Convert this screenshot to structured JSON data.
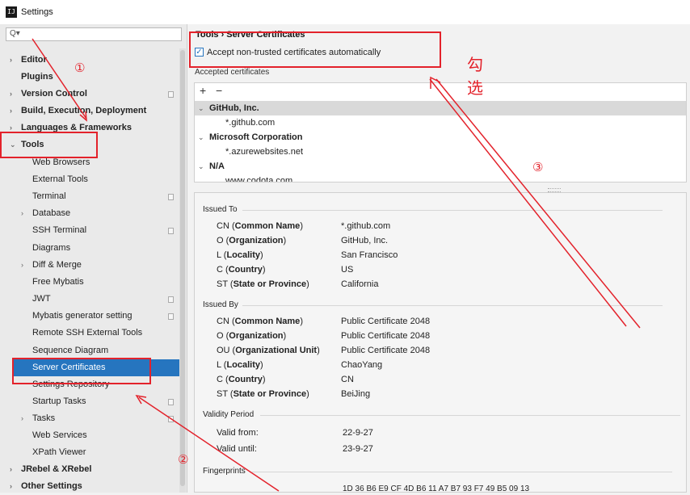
{
  "window": {
    "title": "Settings",
    "app_icon_text": "IJ"
  },
  "search": {
    "value": "",
    "placeholder": ""
  },
  "sidebar": {
    "items": [
      {
        "label": "Editor",
        "expander": "›"
      },
      {
        "label": "Plugins",
        "expander": ""
      },
      {
        "label": "Version Control",
        "expander": "›"
      },
      {
        "label": "Build, Execution, Deployment",
        "expander": "›"
      },
      {
        "label": "Languages & Frameworks",
        "expander": "›"
      },
      {
        "label": "Tools",
        "expander": "⌄"
      },
      {
        "label": "Web Browsers",
        "expander": ""
      },
      {
        "label": "External Tools",
        "expander": ""
      },
      {
        "label": "Terminal",
        "expander": ""
      },
      {
        "label": "Database",
        "expander": "›"
      },
      {
        "label": "SSH Terminal",
        "expander": ""
      },
      {
        "label": "Diagrams",
        "expander": ""
      },
      {
        "label": "Diff & Merge",
        "expander": "›"
      },
      {
        "label": "Free Mybatis",
        "expander": ""
      },
      {
        "label": "JWT",
        "expander": ""
      },
      {
        "label": "Mybatis generator setting",
        "expander": ""
      },
      {
        "label": "Remote SSH External Tools",
        "expander": ""
      },
      {
        "label": "Sequence Diagram",
        "expander": ""
      },
      {
        "label": "Server Certificates",
        "expander": ""
      },
      {
        "label": "Settings Repository",
        "expander": ""
      },
      {
        "label": "Startup Tasks",
        "expander": ""
      },
      {
        "label": "Tasks",
        "expander": "›"
      },
      {
        "label": "Web Services",
        "expander": ""
      },
      {
        "label": "XPath Viewer",
        "expander": ""
      },
      {
        "label": "JRebel & XRebel",
        "expander": "›"
      },
      {
        "label": "Other Settings",
        "expander": "›"
      }
    ]
  },
  "main": {
    "breadcrumb": "Tools  ›  Server Certificates",
    "accept_checkbox": {
      "label": "Accept non-trusted certificates automatically",
      "checked": true,
      "mark": "✓"
    },
    "accepted_label": "Accepted certificates",
    "toolbar": {
      "add": "+",
      "remove": "−"
    },
    "certificates": [
      {
        "type": "group",
        "text": "GitHub, Inc.",
        "expander": "⌄"
      },
      {
        "type": "item",
        "text": "*.github.com"
      },
      {
        "type": "group",
        "text": "Microsoft Corporation",
        "expander": "⌄"
      },
      {
        "type": "item",
        "text": "*.azurewebsites.net"
      },
      {
        "type": "group",
        "text": "N/A",
        "expander": "⌄"
      },
      {
        "type": "item",
        "text": "www.codota.com"
      }
    ]
  },
  "details": {
    "issued_to": {
      "title": "Issued To",
      "fields": [
        {
          "abbr": "CN",
          "name": "Common Name",
          "value": "*.github.com"
        },
        {
          "abbr": "O",
          "name": "Organization",
          "value": "GitHub, Inc."
        },
        {
          "abbr": "L",
          "name": "Locality",
          "value": "San Francisco"
        },
        {
          "abbr": "C",
          "name": "Country",
          "value": "US"
        },
        {
          "abbr": "ST",
          "name": "State or Province",
          "value": "California"
        }
      ]
    },
    "issued_by": {
      "title": "Issued By",
      "fields": [
        {
          "abbr": "CN",
          "name": "Common Name",
          "value": "Public Certificate 2048"
        },
        {
          "abbr": "O",
          "name": "Organization",
          "value": "Public Certificate 2048"
        },
        {
          "abbr": "OU",
          "name": "Organizational Unit",
          "value": "Public Certificate 2048"
        },
        {
          "abbr": "L",
          "name": "Locality",
          "value": "ChaoYang"
        },
        {
          "abbr": "C",
          "name": "Country",
          "value": "CN"
        },
        {
          "abbr": "ST",
          "name": "State or Province",
          "value": "BeiJing"
        }
      ]
    },
    "validity": {
      "title": "Validity Period",
      "fields": [
        {
          "label": "Valid from:",
          "value": "22-9-27"
        },
        {
          "label": "Valid until:",
          "value": "23-9-27"
        }
      ]
    },
    "fingerprints": {
      "title": "Fingerprints",
      "value": "1D 36 B6 E9 CF 4D B6 11 A7 B7 93 F7 49 B5 09 13"
    }
  },
  "annotations": {
    "markers": [
      "①",
      "②",
      "③"
    ],
    "check_note": "勾选",
    "color": "#e3222b"
  }
}
